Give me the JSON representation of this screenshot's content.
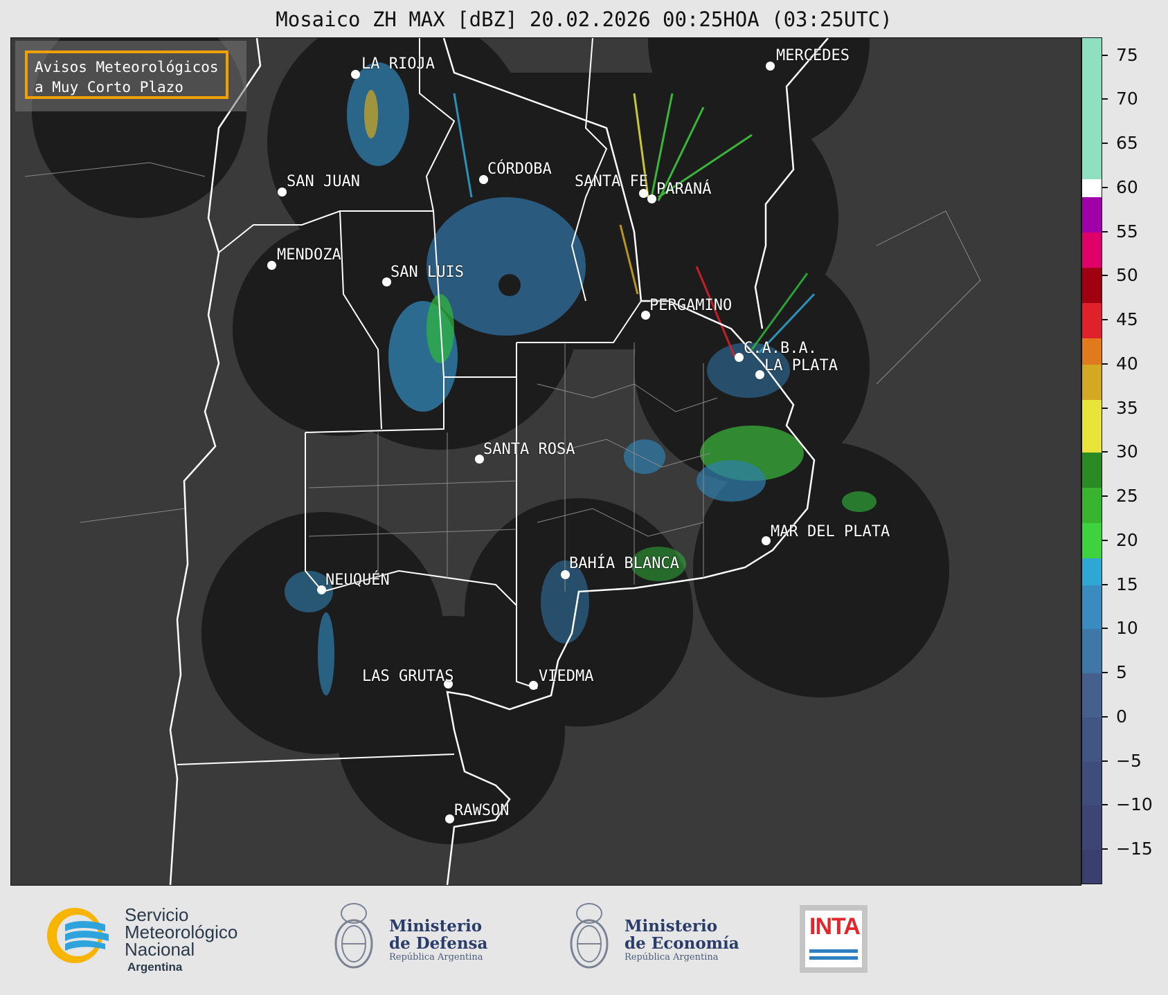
{
  "title": "Mosaico ZH MAX [dBZ] 20.02.2026 00:25HOA (03:25UTC)",
  "notice": {
    "line1": "Avisos Meteorológicos",
    "line2": "a Muy Corto Plazo"
  },
  "cities": [
    {
      "id": "la-rioja",
      "name": "LA RIOJA"
    },
    {
      "id": "mercedes",
      "name": "MERCEDES"
    },
    {
      "id": "san-juan",
      "name": "SAN JUAN"
    },
    {
      "id": "cordoba",
      "name": "CÓRDOBA"
    },
    {
      "id": "santa-fe",
      "name": "SANTA FE"
    },
    {
      "id": "parana",
      "name": "PARANÁ"
    },
    {
      "id": "mendoza",
      "name": "MENDOZA"
    },
    {
      "id": "san-luis",
      "name": "SAN LUIS"
    },
    {
      "id": "pergamino",
      "name": "PERGAMINO"
    },
    {
      "id": "caba",
      "name": "C.A.B.A."
    },
    {
      "id": "la-plata",
      "name": "LA PLATA"
    },
    {
      "id": "santa-rosa",
      "name": "SANTA ROSA"
    },
    {
      "id": "mar-del-plata",
      "name": "MAR DEL PLATA"
    },
    {
      "id": "bahia-blanca",
      "name": "BAHÍA BLANCA"
    },
    {
      "id": "neuquen",
      "name": "NEUQUÉN"
    },
    {
      "id": "las-grutas",
      "name": "LAS GRUTAS"
    },
    {
      "id": "viedma",
      "name": "VIEDMA"
    },
    {
      "id": "rawson",
      "name": "RAWSON"
    }
  ],
  "colorbar": {
    "unit": "dBZ",
    "min": -19,
    "max": 77,
    "ticks": [
      "75",
      "70",
      "65",
      "60",
      "55",
      "50",
      "45",
      "40",
      "35",
      "30",
      "25",
      "20",
      "15",
      "10",
      "5",
      "0",
      "−5",
      "−10",
      "−15"
    ],
    "tick_values": [
      75,
      70,
      65,
      60,
      55,
      50,
      45,
      40,
      35,
      30,
      25,
      20,
      15,
      10,
      5,
      0,
      -5,
      -10,
      -15
    ],
    "bands": [
      {
        "from": -19,
        "to": -15,
        "color": "#3b3f6e"
      },
      {
        "from": -15,
        "to": -10,
        "color": "#3d4574"
      },
      {
        "from": -10,
        "to": -5,
        "color": "#3f4d7c"
      },
      {
        "from": -5,
        "to": 0,
        "color": "#425684"
      },
      {
        "from": 0,
        "to": 5,
        "color": "#45608c"
      },
      {
        "from": 5,
        "to": 10,
        "color": "#3f78a8"
      },
      {
        "from": 10,
        "to": 15,
        "color": "#3a8cc0"
      },
      {
        "from": 15,
        "to": 18,
        "color": "#2ea7d4"
      },
      {
        "from": 18,
        "to": 22,
        "color": "#3fd23f"
      },
      {
        "from": 22,
        "to": 26,
        "color": "#38b42e"
      },
      {
        "from": 26,
        "to": 30,
        "color": "#2a8a24"
      },
      {
        "from": 30,
        "to": 36,
        "color": "#e8e43a"
      },
      {
        "from": 36,
        "to": 40,
        "color": "#d4a820"
      },
      {
        "from": 40,
        "to": 43,
        "color": "#e07a1c"
      },
      {
        "from": 43,
        "to": 47,
        "color": "#e0202a"
      },
      {
        "from": 47,
        "to": 51,
        "color": "#a00010"
      },
      {
        "from": 51,
        "to": 55,
        "color": "#e0006a"
      },
      {
        "from": 55,
        "to": 59,
        "color": "#a000a8"
      },
      {
        "from": 59,
        "to": 61,
        "color": "#ffffff"
      },
      {
        "from": 61,
        "to": 77,
        "color": "#8ee0c0"
      }
    ]
  },
  "footer": {
    "smn_line1": "Servicio",
    "smn_line2": "Meteorológico",
    "smn_line3": "Nacional",
    "smn_line4": "Argentina",
    "defensa_line1": "Ministerio",
    "defensa_line2": "de Defensa",
    "defensa_line3": "República Argentina",
    "economia_line1": "Ministerio",
    "economia_line2": "de Economía",
    "economia_line3": "República Argentina",
    "inta": "INTA"
  },
  "colors": {
    "background": "#3a3a3a",
    "radar_coverage": "#1c1c1c",
    "notice_border": "#f0a000",
    "borders": "#ffffff"
  }
}
